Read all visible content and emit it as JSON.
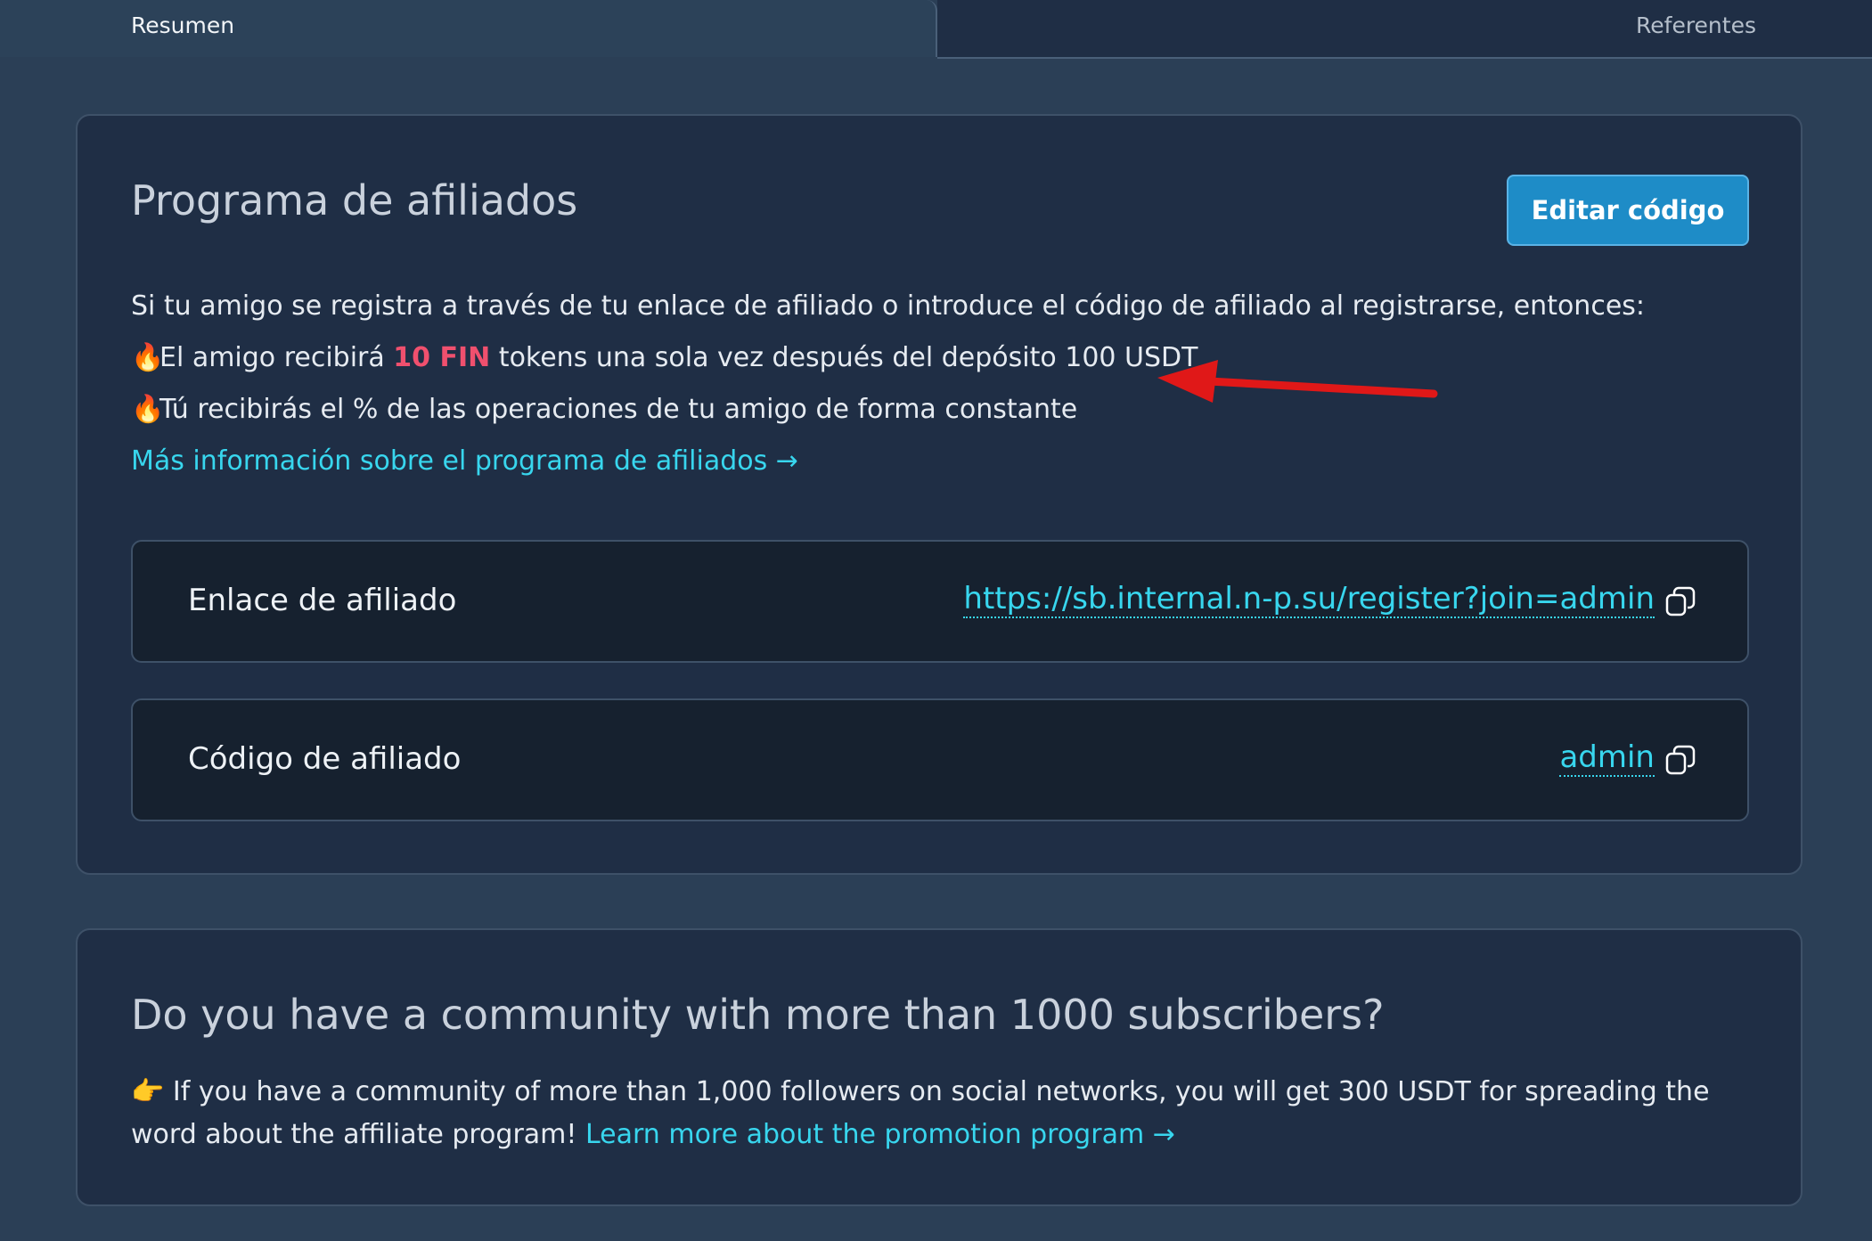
{
  "tabs": {
    "summary_label": "Resumen",
    "referrals_label": "Referentes"
  },
  "affiliate": {
    "title": "Programa de afiliados",
    "edit_button": "Editar código",
    "intro": "Si tu amigo se registra a través de tu enlace de afiliado o introduce el código de afiliado al registrarse, entonces:",
    "benefit1_prefix": "El amigo recibirá ",
    "benefit1_highlight": "10 FIN",
    "benefit1_suffix": " tokens una sola vez después del depósito 100 USDT",
    "benefit2": "Tú recibirás el % de las operaciones de tu amigo de forma constante",
    "benefit_icon": "🔥",
    "more_info_link": "Más información sobre el programa de afiliados →",
    "link_label": "Enlace de afiliado",
    "link_value": "https://sb.internal.n-p.su/register?join=admin",
    "code_label": "Código de afiliado",
    "code_value": "admin"
  },
  "community": {
    "title": "Do you have a community with more than 1000 subscribers?",
    "pointer_icon": "👉",
    "text": "If you have a community of more than 1,000 followers on social networks, you will get 300 USDT for spreading the word about the affiliate program!",
    "link": "Learn more about the promotion program →"
  },
  "colors": {
    "background": "#2b3f56",
    "card": "#1f2e45",
    "accent_link": "#38d6ee",
    "button": "#1e8cc7",
    "highlight": "#f0506e",
    "annotation_arrow": "#e01818"
  }
}
